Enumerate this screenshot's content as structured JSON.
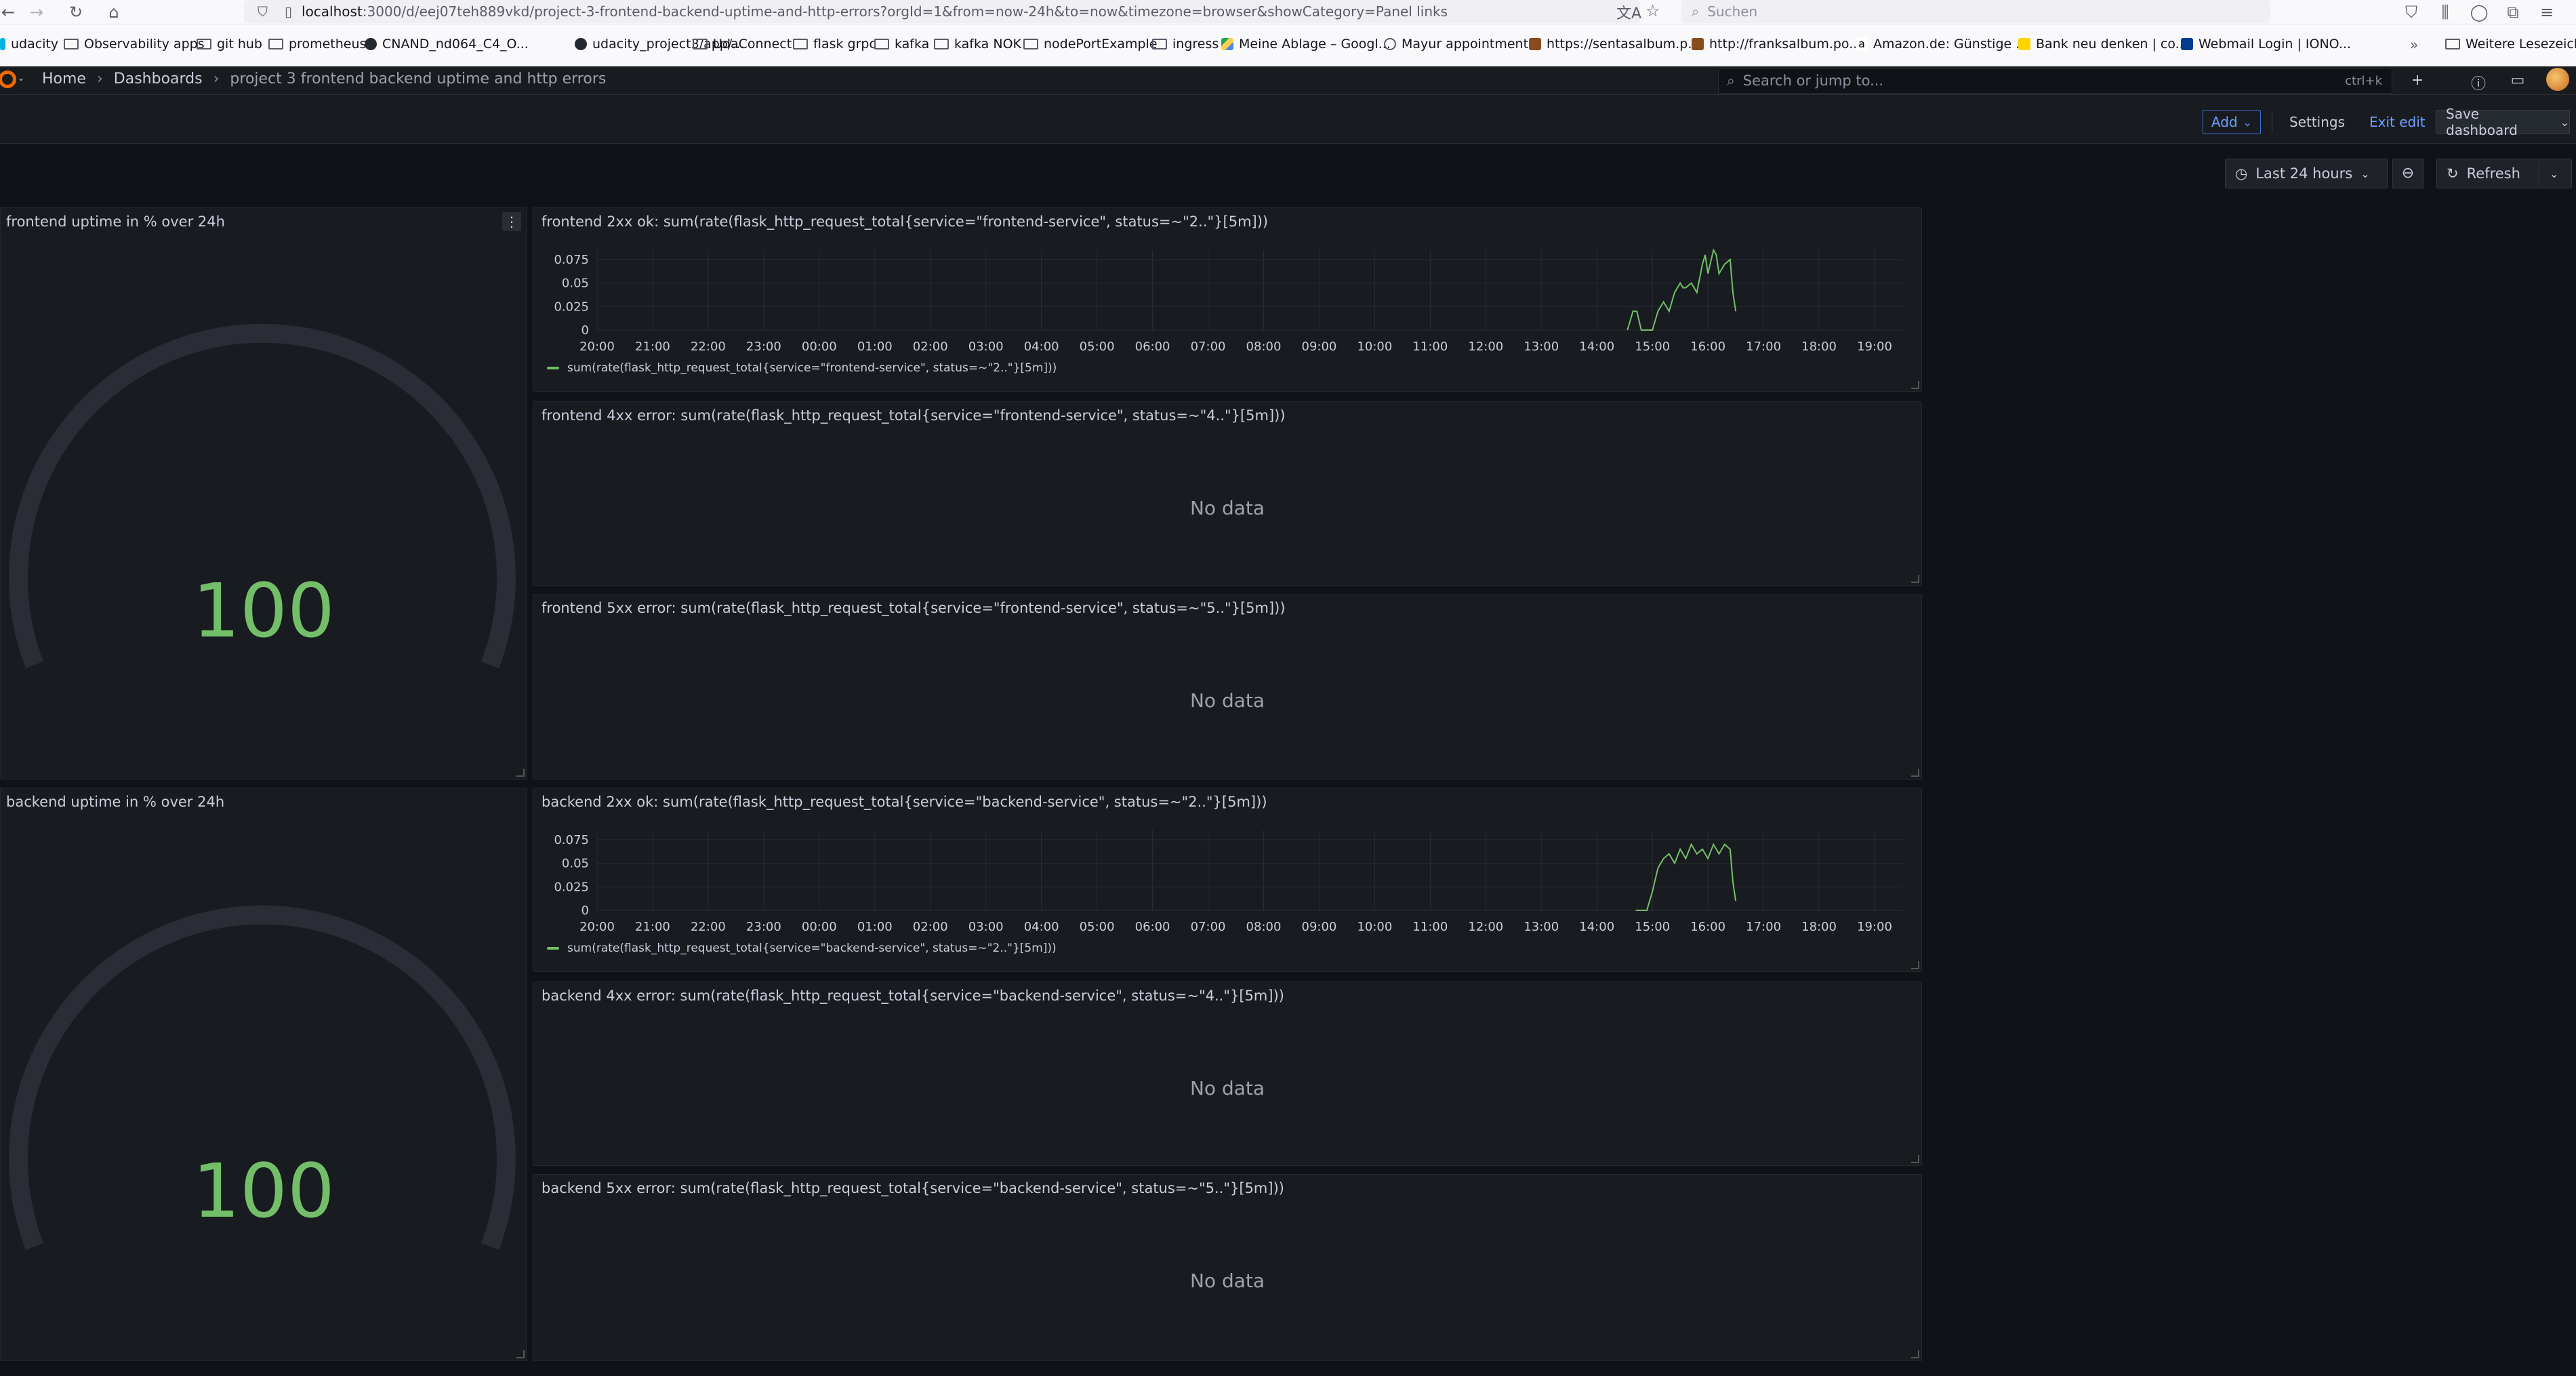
{
  "browser": {
    "url_host": "localhost",
    "url_rest": ":3000/d/eej07teh889vkd/project-3-frontend-backend-uptime-and-http-errors?orgId=1&from=now-24h&to=now&timezone=browser&showCategory=Panel links",
    "search_placeholder": "Suchen",
    "bookmarks": [
      "udacity",
      "Observability apps",
      "git hub",
      "prometheus",
      "CNAND_nd064_C4_O...",
      "udacity_project3/app/...",
      "UdaConnect",
      "flask grpc",
      "kafka",
      "kafka NOK",
      "nodePortExample",
      "ingress",
      "Meine Ablage – Googl...",
      "Mayur appointments",
      "https://sentasalbum.p...",
      "http://franksalbum.po...",
      "Amazon.de: Günstige ...",
      "Bank neu denken | co...",
      "Webmail Login | IONO...",
      "Weitere Lesezeichen"
    ]
  },
  "grafana": {
    "breadcrumb": [
      "Home",
      "Dashboards",
      "project 3 frontend backend uptime and http errors"
    ],
    "search_placeholder": "Search or jump to...",
    "search_shortcut": "ctrl+k",
    "toolbar": {
      "add_label": "Add",
      "settings_label": "Settings",
      "exit_label": "Exit edit",
      "save_label": "Save dashboard"
    },
    "time_range": "Last 24 hours",
    "refresh_label": "Refresh",
    "colors": {
      "accent": "#6e9fff",
      "series": "#73bf69",
      "panel_bg": "#181b1f",
      "page_bg": "#111217"
    }
  },
  "panels": {
    "frontend_uptime": {
      "title": "frontend uptime in % over 24h",
      "value": "100"
    },
    "backend_uptime": {
      "title": "backend uptime in % over 24h",
      "value": "100"
    },
    "frontend_2xx": {
      "title": "frontend 2xx ok: sum(rate(flask_http_request_total{service=\"frontend-service\", status=~\"2..\"}[5m]))",
      "legend": "sum(rate(flask_http_request_total{service=\"frontend-service\", status=~\"2..\"}[5m]))"
    },
    "frontend_4xx": {
      "title": "frontend 4xx error: sum(rate(flask_http_request_total{service=\"frontend-service\", status=~\"4..\"}[5m]))",
      "nodata": "No data"
    },
    "frontend_5xx": {
      "title": "frontend 5xx error: sum(rate(flask_http_request_total{service=\"frontend-service\", status=~\"5..\"}[5m]))",
      "nodata": "No data"
    },
    "backend_2xx": {
      "title": "backend 2xx ok: sum(rate(flask_http_request_total{service=\"backend-service\", status=~\"2..\"}[5m]))",
      "legend": "sum(rate(flask_http_request_total{service=\"backend-service\", status=~\"2..\"}[5m]))"
    },
    "backend_4xx": {
      "title": "backend 4xx error: sum(rate(flask_http_request_total{service=\"backend-service\", status=~\"4..\"}[5m]))",
      "nodata": "No data"
    },
    "backend_5xx": {
      "title": "backend 5xx error: sum(rate(flask_http_request_total{service=\"backend-service\", status=~\"5..\"}[5m]))",
      "nodata": "No data"
    }
  },
  "chart_data": [
    {
      "type": "line",
      "xlabel": "",
      "ylabel": "",
      "x_ticks": [
        "20:00",
        "21:00",
        "22:00",
        "23:00",
        "00:00",
        "01:00",
        "02:00",
        "03:00",
        "04:00",
        "05:00",
        "06:00",
        "07:00",
        "08:00",
        "09:00",
        "10:00",
        "11:00",
        "12:00",
        "13:00",
        "14:00",
        "15:00",
        "16:00",
        "17:00",
        "18:00",
        "19:00"
      ],
      "y_ticks": [
        "0",
        "0.025",
        "0.05",
        "0.075"
      ],
      "ylim": [
        0,
        0.085
      ],
      "xlim_hours": [
        0,
        23.5
      ],
      "grid": true,
      "legend_position": "bottom-left",
      "series": [
        {
          "name": "sum(rate(flask_http_request_total{service=\"frontend-service\", status=~\"2..\"}[5m]))",
          "x": [
            18.55,
            18.65,
            18.72,
            18.8,
            18.9,
            19.0,
            19.1,
            19.2,
            19.3,
            19.4,
            19.5,
            19.55,
            19.6,
            19.7,
            19.8,
            19.9,
            19.95,
            20.0,
            20.1,
            20.15,
            20.2,
            20.3,
            20.4,
            20.45,
            20.5
          ],
          "y": [
            0,
            0.02,
            0.02,
            0,
            0,
            0,
            0.02,
            0.03,
            0.02,
            0.04,
            0.05,
            0.045,
            0.045,
            0.05,
            0.04,
            0.07,
            0.08,
            0.06,
            0.085,
            0.08,
            0.06,
            0.07,
            0.075,
            0.04,
            0.02
          ]
        }
      ]
    },
    {
      "type": "line",
      "xlabel": "",
      "ylabel": "",
      "x_ticks": [
        "20:00",
        "21:00",
        "22:00",
        "23:00",
        "00:00",
        "01:00",
        "02:00",
        "03:00",
        "04:00",
        "05:00",
        "06:00",
        "07:00",
        "08:00",
        "09:00",
        "10:00",
        "11:00",
        "12:00",
        "13:00",
        "14:00",
        "15:00",
        "16:00",
        "17:00",
        "18:00",
        "19:00"
      ],
      "y_ticks": [
        "0",
        "0.025",
        "0.05",
        "0.075"
      ],
      "ylim": [
        0,
        0.085
      ],
      "xlim_hours": [
        0,
        23.5
      ],
      "grid": true,
      "legend_position": "bottom-left",
      "series": [
        {
          "name": "sum(rate(flask_http_request_total{service=\"backend-service\", status=~\"2..\"}[5m]))",
          "x": [
            18.7,
            18.9,
            19.0,
            19.1,
            19.2,
            19.3,
            19.4,
            19.5,
            19.6,
            19.7,
            19.8,
            19.9,
            20.0,
            20.1,
            20.2,
            20.3,
            20.4,
            20.45,
            20.5
          ],
          "y": [
            0,
            0,
            0.02,
            0.045,
            0.055,
            0.06,
            0.05,
            0.065,
            0.055,
            0.07,
            0.06,
            0.065,
            0.055,
            0.07,
            0.06,
            0.07,
            0.065,
            0.03,
            0.01
          ]
        }
      ]
    }
  ]
}
